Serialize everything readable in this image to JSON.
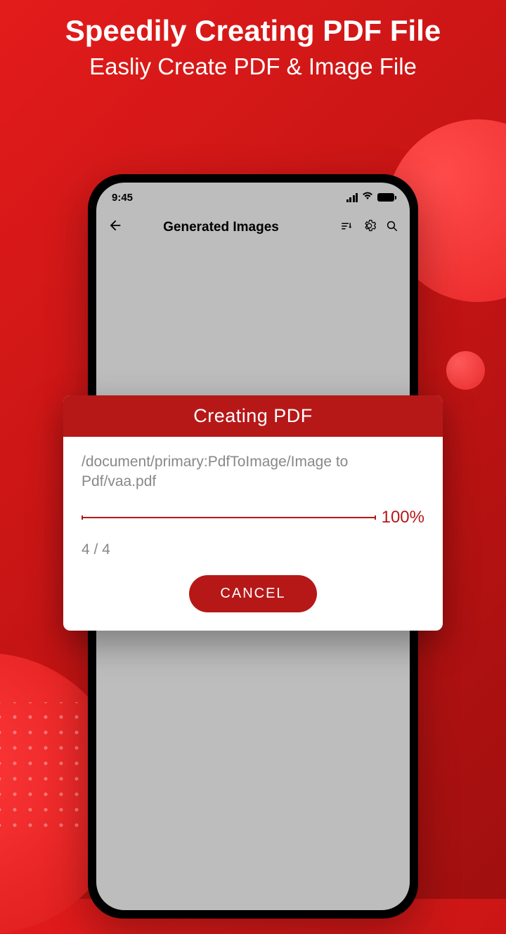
{
  "promo": {
    "title": "Speedily Creating PDF File",
    "subtitle": "Easliy Create PDF & Image File"
  },
  "status": {
    "time": "9:45"
  },
  "header": {
    "title": "Generated Images"
  },
  "dialog": {
    "title": "Creating PDF",
    "file_path": "/document/primary:PdfToImage/Image to Pdf/vaa.pdf",
    "progress_percent": "100%",
    "page_count": "4 / 4",
    "cancel_label": "CANCEL"
  }
}
